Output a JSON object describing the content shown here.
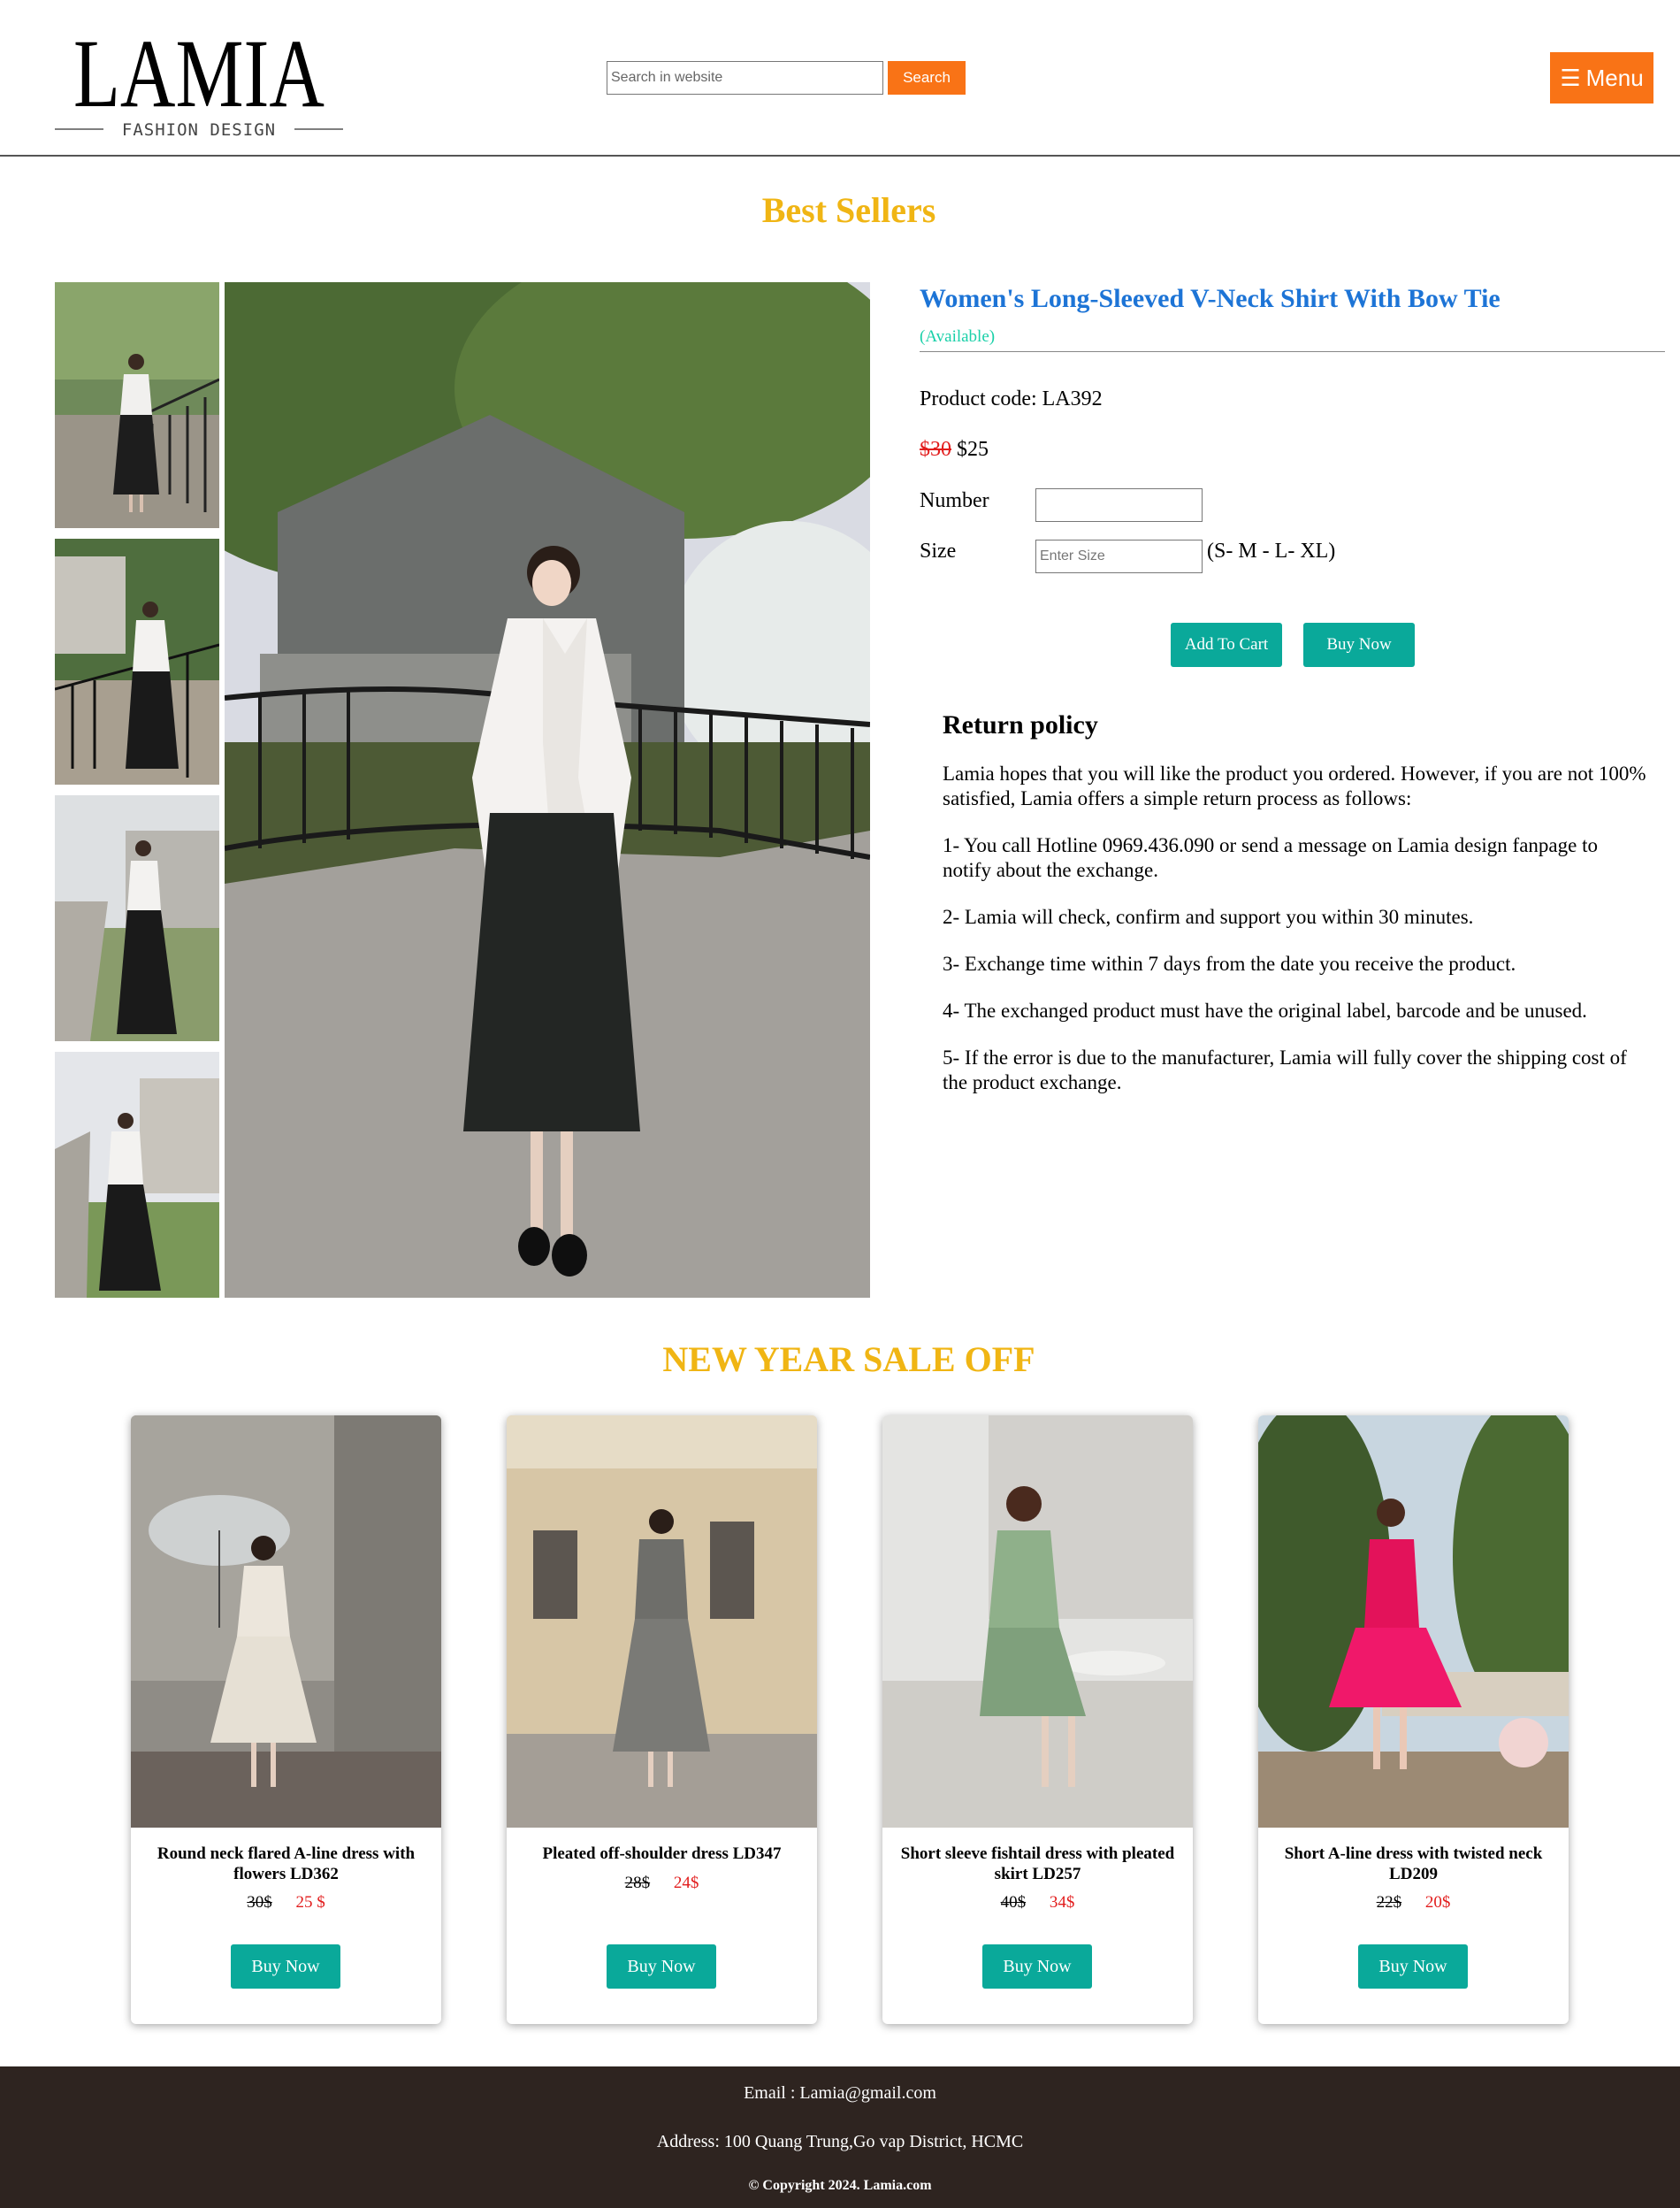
{
  "header": {
    "logo": {
      "name": "LAMIA",
      "tagline": "FASHION DESIGN"
    },
    "search": {
      "placeholder": "Search in website",
      "button_label": "Search"
    },
    "menu": {
      "icon": "hamburger-icon",
      "label": "Menu"
    }
  },
  "best_sellers": {
    "title": "Best Sellers",
    "thumbnails": [
      "thumbnail-1",
      "thumbnail-2",
      "thumbnail-3",
      "thumbnail-4"
    ]
  },
  "product": {
    "name": "Women's Long-Sleeved V-Neck Shirt With Bow Tie",
    "availability": "(Available)",
    "code_label": "Product code: LA392",
    "old_price": "$30",
    "new_price": "$25",
    "number_label": "Number",
    "number_value": "",
    "size_label": "Size",
    "size_placeholder": "Enter Size",
    "size_hint": "(S- M - L- XL)",
    "add_to_cart_label": "Add To Cart",
    "buy_now_label": "Buy Now"
  },
  "return_policy": {
    "title": "Return policy",
    "paragraphs": [
      "Lamia hopes that you will like the product you ordered. However, if you are not 100% satisfied, Lamia offers a simple return process as follows:",
      "1- You call Hotline 0969.436.090 or send a message on Lamia design fanpage to notify about the exchange.",
      "2- Lamia will check, confirm and support you within 30 minutes.",
      "3- Exchange time within 7 days from the date you receive the product.",
      "4- The exchanged product must have the original label, barcode and be unused.",
      "5- If the error is due to the manufacturer, Lamia will fully cover the shipping cost of the product exchange."
    ]
  },
  "sale": {
    "title": "NEW YEAR SALE OFF",
    "cards": [
      {
        "name": "Round neck flared A-line dress with flowers LD362",
        "old_price": "30$",
        "new_price": "25 $",
        "button": "Buy Now"
      },
      {
        "name": "Pleated off-shoulder dress LD347",
        "old_price": "28$",
        "new_price": "24$",
        "button": "Buy Now"
      },
      {
        "name": "Short sleeve fishtail dress with pleated skirt LD257",
        "old_price": "40$",
        "new_price": "34$",
        "button": "Buy Now"
      },
      {
        "name": "Short A-line dress with twisted neck LD209",
        "old_price": "22$",
        "new_price": "20$",
        "button": "Buy Now"
      }
    ]
  },
  "footer": {
    "email": "Email : Lamia@gmail.com",
    "address": "Address: 100 Quang Trung,Go vap District, HCMC",
    "copyright": "© Copyright 2024. Lamia.com"
  },
  "colors": {
    "accent_orange": "#f97316",
    "title_gold": "#f0b514",
    "product_blue": "#1d74d6",
    "teal_button": "#0aa99a",
    "sale_red": "#e21d1d",
    "footer_bg": "#2e2420"
  }
}
